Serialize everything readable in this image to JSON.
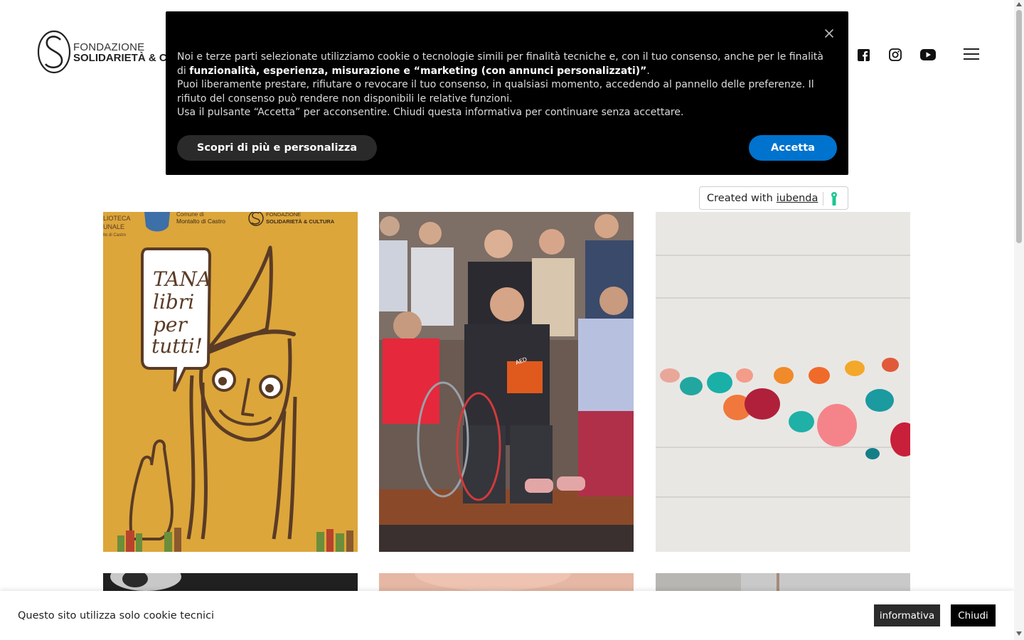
{
  "brand": {
    "name_top": "FONDAZIONE",
    "name_bottom": "SOLIDARIETÀ & CULTURA"
  },
  "header": {
    "social": [
      "facebook-icon",
      "instagram-icon",
      "youtube-icon"
    ],
    "menu_icon": "hamburger-menu-icon"
  },
  "cookie_banner": {
    "text_1": "Noi e terze parti selezionate utilizziamo cookie o tecnologie simili per finalità tecniche e, con il tuo consenso, anche per le finalità di ",
    "text_bold": "funzionalità, esperienza, misurazione e “marketing (con annunci personalizzati)”",
    "text_2": ".",
    "text_3": "Puoi liberamente prestare, rifiutare o revocare il tuo consenso, in qualsiasi momento, accedendo al pannello delle preferenze. Il rifiuto del consenso può rendere non disponibili le relative funzioni.",
    "text_4": "Usa il pulsante “Accetta” per acconsentire. Chiudi questa informativa per continuare senza accettare.",
    "customize_label": "Scopri di più e personalizza",
    "accept_label": "Accetta",
    "close_icon": "close-icon"
  },
  "iubenda": {
    "created_with": "Created with",
    "link": "iubenda"
  },
  "posts": {
    "tile1": {
      "poster_text": [
        "TANA",
        "libri",
        "per",
        "tutti!"
      ],
      "header_left_1": "LIOTECA",
      "header_left_2": "UNALE",
      "header_left_3": "lto di Castro",
      "header_mid_1": "Comune di",
      "header_mid_2": "Montalto di Castro",
      "header_right_1": "FONDAZIONE",
      "header_right_2": "SOLIDARIETÀ & CULTURA"
    },
    "tile2": {
      "badge_text": "AED"
    }
  },
  "bottom_bar": {
    "text": "Questo sito utilizza solo cookie tecnici",
    "informativa_label": "informativa",
    "chiudi_label": "Chiudi"
  },
  "colors": {
    "accent": "#0073ce",
    "poster_bg": "#dca63a",
    "poster_ink": "#5a3b26"
  }
}
